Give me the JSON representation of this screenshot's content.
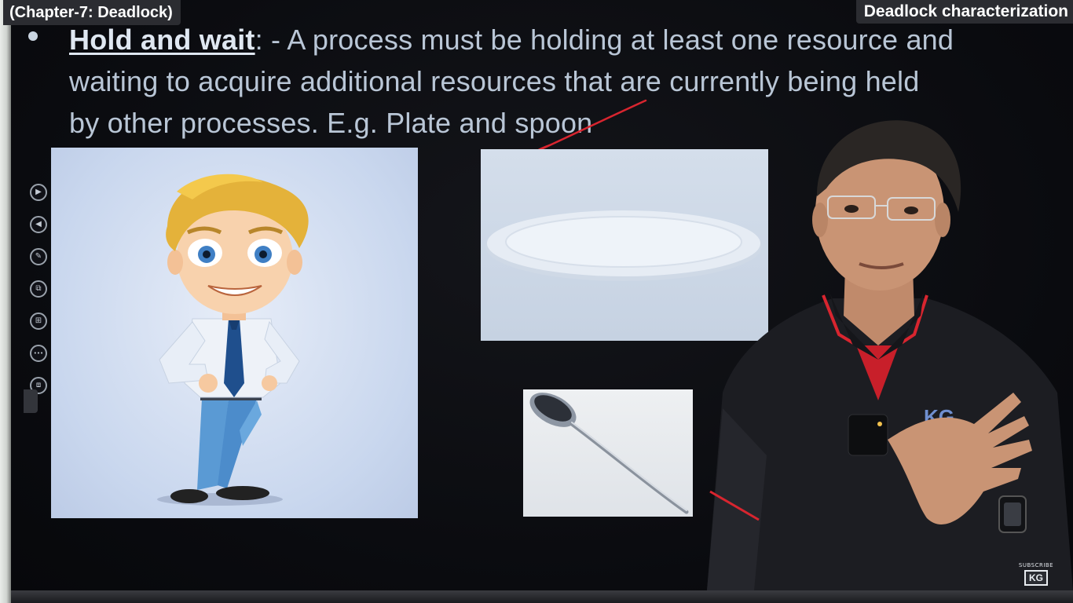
{
  "overlay": {
    "chapter_label": "(Chapter-7: Deadlock)",
    "topic_label": "Deadlock characterization"
  },
  "slide": {
    "term": "Hold and wait",
    "definition_part1": ": - A process must be holding at least one resource and",
    "definition_part2": "waiting to acquire additional resources that are currently being held",
    "definition_part3": "by other processes. E.g. Plate and spoon"
  },
  "presenter_shirt_logo": "KG",
  "tools": [
    {
      "name": "next-slide-icon",
      "glyph": "▶"
    },
    {
      "name": "previous-slide-icon",
      "glyph": "◀"
    },
    {
      "name": "pen-icon",
      "glyph": "✎"
    },
    {
      "name": "slides-icon",
      "glyph": "⧉"
    },
    {
      "name": "zoom-icon",
      "glyph": "⊞"
    },
    {
      "name": "more-icon",
      "glyph": "•••"
    },
    {
      "name": "subtitles-icon",
      "glyph": "⧈"
    }
  ],
  "subscribe": {
    "text": "SUBSCRIBE",
    "logo": "KG"
  },
  "colors": {
    "slide_text": "#b9c6d6",
    "annotation_red": "#d8252f",
    "shirt_accent": "#d8252f"
  }
}
